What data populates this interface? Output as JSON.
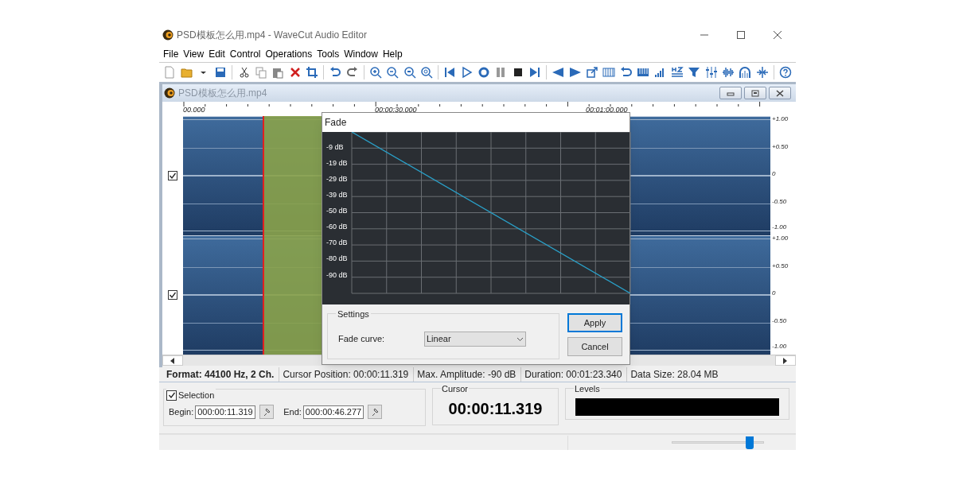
{
  "window": {
    "title": "PSD模板怎么用.mp4 - WaveCut Audio Editor"
  },
  "menu": [
    "File",
    "View",
    "Edit",
    "Control",
    "Operations",
    "Tools",
    "Window",
    "Help"
  ],
  "document": {
    "title": "PSD模板怎么用.mp4",
    "ruler_labels": [
      "00.000",
      "00:00:30.000",
      "00:01:00.000"
    ],
    "channels": [
      {
        "checked": true,
        "scale": [
          "+1.00",
          "+0.50",
          "0",
          "-0.50",
          "-1.00"
        ]
      },
      {
        "checked": true,
        "scale": [
          "+1.00",
          "+0.50",
          "0",
          "-0.50",
          "-1.00"
        ]
      }
    ]
  },
  "fade_dialog": {
    "title": "Fade",
    "y_labels": [
      "-9 dB",
      "-19 dB",
      "-29 dB",
      "-39 dB",
      "-50 dB",
      "-60 dB",
      "-70 dB",
      "-80 dB",
      "-90 dB"
    ],
    "settings_title": "Settings",
    "fade_curve_label": "Fade curve:",
    "fade_curve": "Linear",
    "buttons": [
      {
        "label": "Apply",
        "focused": true
      },
      {
        "label": "Cancel",
        "focused": false
      }
    ]
  },
  "status_bar": [
    {
      "text": "Format: 44100 Hz, 2 Ch.",
      "emphasized": true
    },
    {
      "text": "Cursor Position: 00:00:11.319",
      "emphasized": false
    },
    {
      "text": "Max. Amplitude: -90 dB",
      "emphasized": false
    },
    {
      "text": "Duration: 00:01:23.340",
      "emphasized": false
    },
    {
      "text": "Data Size: 28.04 MB",
      "emphasized": false
    }
  ],
  "selection": {
    "title": "Selection",
    "checked": true,
    "begin_label": "Begin:",
    "begin": "000:00:11.319",
    "end_label": "End:",
    "end": "000:00:46.277"
  },
  "cursor": {
    "title": "Cursor",
    "time": "00:00:11.319"
  },
  "levels": {
    "title": "Levels"
  },
  "zoom_slider": {
    "level": 0.86
  }
}
